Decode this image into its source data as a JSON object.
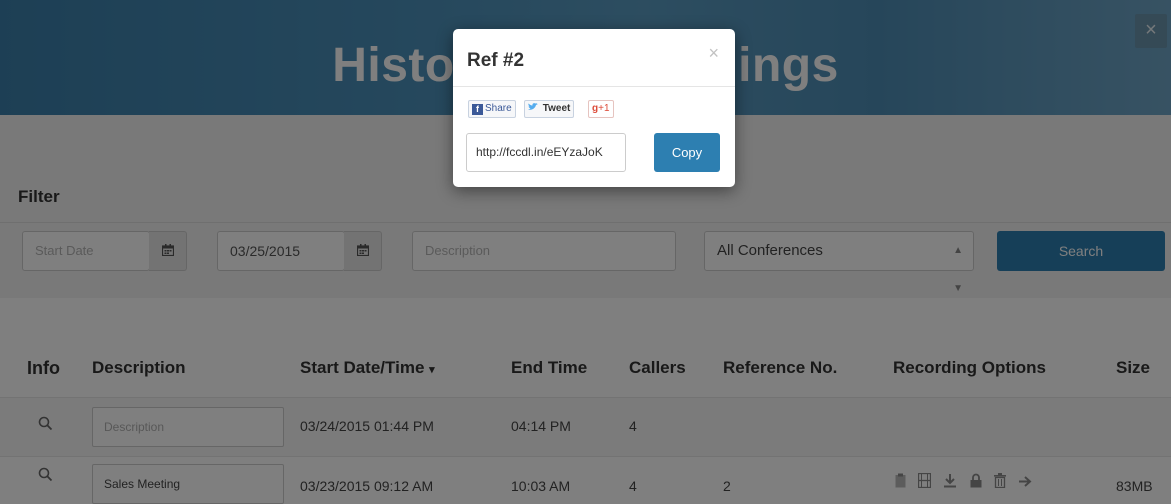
{
  "page": {
    "title": "Historical Recordings",
    "close_label": "×"
  },
  "filter": {
    "label": "Filter",
    "start_date_placeholder": "Start Date",
    "end_date_value": "03/25/2015",
    "description_placeholder": "Description",
    "conference_select": "All Conferences",
    "search_label": "Search",
    "calendar_icon": "calendar-icon"
  },
  "table": {
    "headers": {
      "info": "Info",
      "description": "Description",
      "start": "Start Date/Time",
      "start_sort": "▾",
      "end": "End Time",
      "callers": "Callers",
      "reference": "Reference No.",
      "options": "Recording Options",
      "size": "Size"
    },
    "rows": [
      {
        "description_placeholder": "Description",
        "description": "",
        "start": "03/24/2015 01:44 PM",
        "end": "04:14 PM",
        "callers": "4",
        "reference": "",
        "size": ""
      },
      {
        "description_placeholder": "",
        "description": "Sales Meeting",
        "start": "03/23/2015 09:12 AM",
        "end": "10:03 AM",
        "callers": "4",
        "reference": "2",
        "size": "83MB"
      }
    ],
    "option_icons": [
      "clipboard-icon",
      "film-icon",
      "download-icon",
      "lock-icon",
      "trash-icon",
      "share-arrow-icon"
    ]
  },
  "modal": {
    "title": "Ref #2",
    "close": "×",
    "facebook_label": "Share",
    "tweet_label": "Tweet",
    "gplus_label": "+1",
    "link_value": "http://fccdl.in/eEYzaJoK",
    "copy_label": "Copy"
  },
  "colors": {
    "accent": "#2d7fb1",
    "hero": "#4b90ba",
    "overlay": "rgba(0,0,0,0.5)"
  }
}
